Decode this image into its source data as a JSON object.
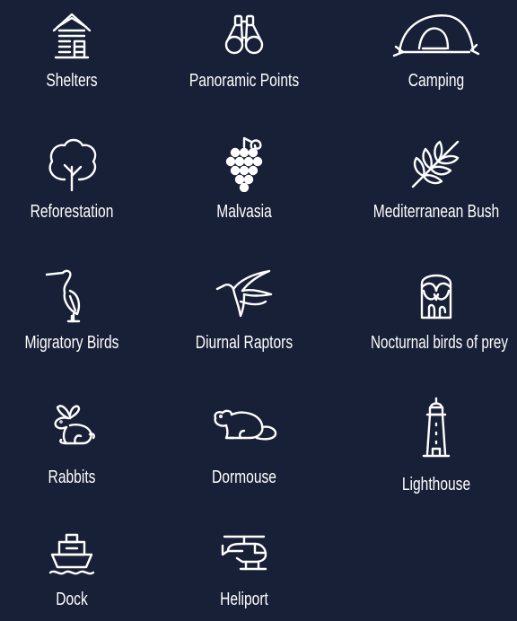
{
  "background_color": "#182037",
  "icon_color": "#ffffff",
  "items": [
    {
      "label": "Shelters",
      "icon": "shelter-icon"
    },
    {
      "label": "Panoramic Points",
      "icon": "binoculars-icon"
    },
    {
      "label": "Camping",
      "icon": "tent-icon"
    },
    {
      "label": "Reforestation",
      "icon": "tree-icon"
    },
    {
      "label": "Malvasia",
      "icon": "grapes-icon"
    },
    {
      "label": "Mediterranean Bush",
      "icon": "olive-branch-icon"
    },
    {
      "label": "Migratory Birds",
      "icon": "heron-icon"
    },
    {
      "label": "Diurnal Raptors",
      "icon": "swallow-icon"
    },
    {
      "label": "Nocturnal birds of prey",
      "icon": "owl-icon"
    },
    {
      "label": "Rabbits",
      "icon": "rabbit-icon"
    },
    {
      "label": "Dormouse",
      "icon": "dormouse-icon"
    },
    {
      "label": "Lighthouse",
      "icon": "lighthouse-icon"
    },
    {
      "label": "Dock",
      "icon": "ship-icon"
    },
    {
      "label": "Heliport",
      "icon": "helicopter-icon"
    }
  ]
}
